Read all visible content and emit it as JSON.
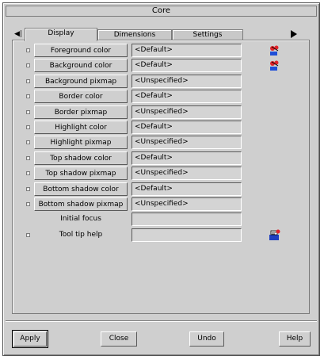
{
  "window": {
    "title": "Core"
  },
  "tabs": [
    {
      "label": "Display",
      "active": true
    },
    {
      "label": "Dimensions",
      "active": false
    },
    {
      "label": "Settings",
      "active": false
    }
  ],
  "rows": [
    {
      "label": "Foreground color",
      "value": "<Default>",
      "is_button": true,
      "icon": "color-swatch-icon"
    },
    {
      "label": "Background color",
      "value": "<Default>",
      "is_button": true,
      "icon": "color-swatch-icon"
    },
    {
      "label": "Background pixmap",
      "value": "<Unspecified>",
      "is_button": true
    },
    {
      "label": "Border color",
      "value": "<Default>",
      "is_button": true
    },
    {
      "label": "Border pixmap",
      "value": "<Unspecified>",
      "is_button": true
    },
    {
      "label": "Highlight color",
      "value": "<Default>",
      "is_button": true
    },
    {
      "label": "Highlight pixmap",
      "value": "<Unspecified>",
      "is_button": true
    },
    {
      "label": "Top shadow color",
      "value": "<Default>",
      "is_button": true
    },
    {
      "label": "Top shadow pixmap",
      "value": "<Unspecified>",
      "is_button": true
    },
    {
      "label": "Bottom shadow color",
      "value": "<Default>",
      "is_button": true
    },
    {
      "label": "Bottom shadow pixmap",
      "value": "<Unspecified>",
      "is_button": true
    },
    {
      "label": "Initial focus",
      "value": "",
      "is_button": false,
      "no_checkbox": true
    },
    {
      "label": "Tool tip help",
      "value": "",
      "is_button": false,
      "icon": "tooltip-help-icon"
    }
  ],
  "buttons": {
    "apply": "Apply",
    "close": "Close",
    "undo": "Undo",
    "help": "Help"
  },
  "colors": {
    "window_bg": "#cfcfcf",
    "field_bg": "#d4d4d4"
  }
}
